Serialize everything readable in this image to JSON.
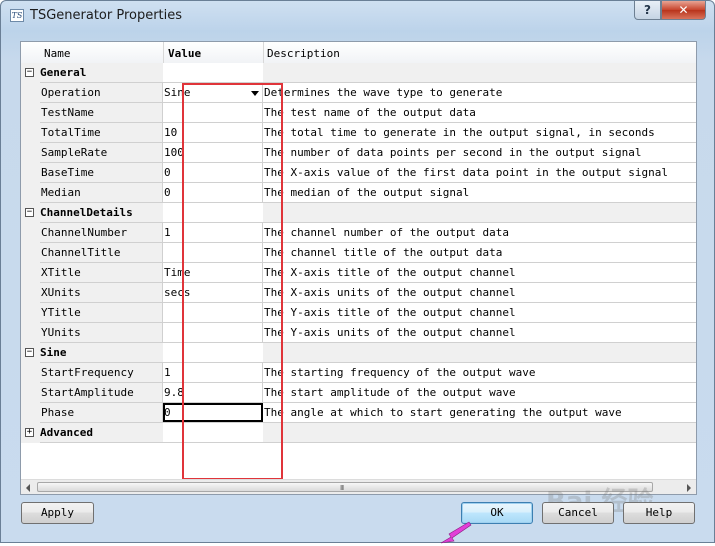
{
  "window": {
    "title": "TSGenerator Properties",
    "icon_text": "TS",
    "help_button": "?",
    "close_button": "✕"
  },
  "grid": {
    "headers": {
      "name": "Name",
      "value": "Value",
      "description": "Description"
    },
    "categories": [
      {
        "name": "General",
        "toggle": "−",
        "properties": [
          {
            "name": "Operation",
            "value": "Sine",
            "description": "Determines the wave type to generate",
            "dropdown": true
          },
          {
            "name": "TestName",
            "value": "",
            "description": "The test name of the output data"
          },
          {
            "name": "TotalTime",
            "value": "10",
            "description": "The total time to generate in the output signal, in seconds"
          },
          {
            "name": "SampleRate",
            "value": "100",
            "description": "The number of data points per second in the output signal"
          },
          {
            "name": "BaseTime",
            "value": "0",
            "description": "The X-axis value of the first data point in the output signal"
          },
          {
            "name": "Median",
            "value": "0",
            "description": "The median of the output signal"
          }
        ]
      },
      {
        "name": "ChannelDetails",
        "toggle": "−",
        "properties": [
          {
            "name": "ChannelNumber",
            "value": "1",
            "description": "The channel number of the output data"
          },
          {
            "name": "ChannelTitle",
            "value": "",
            "description": "The channel title of the output data"
          },
          {
            "name": "XTitle",
            "value": "Time",
            "description": "The X-axis title of the output channel"
          },
          {
            "name": "XUnits",
            "value": "secs",
            "description": "The X-axis units of the output channel"
          },
          {
            "name": "YTitle",
            "value": "",
            "description": "The Y-axis title of the output channel"
          },
          {
            "name": "YUnits",
            "value": "",
            "description": "The Y-axis units of the output channel"
          }
        ]
      },
      {
        "name": "Sine",
        "toggle": "−",
        "properties": [
          {
            "name": "StartFrequency",
            "value": "1",
            "description": "The starting frequency of the output wave"
          },
          {
            "name": "StartAmplitude",
            "value": "9.8",
            "description": "The start amplitude of the output wave"
          },
          {
            "name": "Phase",
            "value": "0",
            "description": "The angle at which to start generating the output wave",
            "editing": true
          }
        ]
      },
      {
        "name": "Advanced",
        "toggle": "+",
        "properties": []
      }
    ]
  },
  "scrollbar": {
    "grip": "III"
  },
  "buttons": {
    "apply": "Apply",
    "ok": "OK",
    "cancel": "Cancel",
    "help": "Help"
  },
  "watermark": "Bai 经验",
  "colors": {
    "highlight": "#e0343a",
    "pointer": "#e23fd8"
  }
}
